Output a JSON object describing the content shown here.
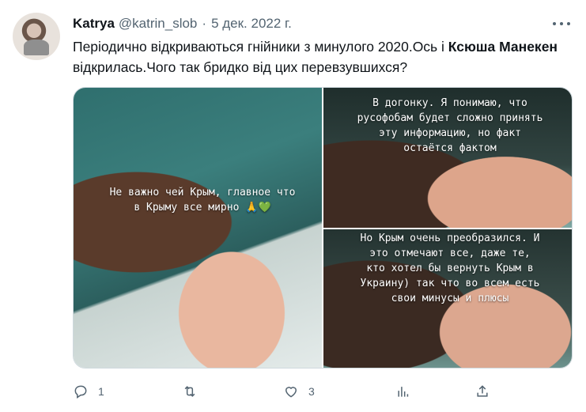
{
  "tweet": {
    "name": "Katrya",
    "handle": "@katrin_slob",
    "separator": "·",
    "date": "5 дек. 2022 г.",
    "text_part1": "Періодично відкриваються гнійники з минулого 2020.Ось і ",
    "text_bold": "Ксюша Манекен",
    "text_part2": " відкрилась.Чого так бридко від цих перевзувшихся?"
  },
  "media": {
    "caption1": "Не важно чей Крым, главное что\nв Крыму все мирно 🙏",
    "caption1_heart": "💚",
    "caption2": "В догонку. Я понимаю, что\nрусофобам будет сложно принять\nэту информацию, но факт\nостаётся фактом",
    "caption3": "Но Крым очень преобразился. И\nэто отмечают все, даже те,\nкто хотел бы вернуть Крым в\nУкраину) так что во всем есть\nсвои минусы и плюсы"
  },
  "actions": {
    "reply_count": "1",
    "like_count": "3"
  },
  "icons": [
    "more-icon",
    "reply-icon",
    "retweet-icon",
    "like-icon",
    "views-icon",
    "share-icon"
  ],
  "colors": {
    "secondary_text": "#536471",
    "primary_text": "#0f1419",
    "border": "#cfd9de"
  }
}
